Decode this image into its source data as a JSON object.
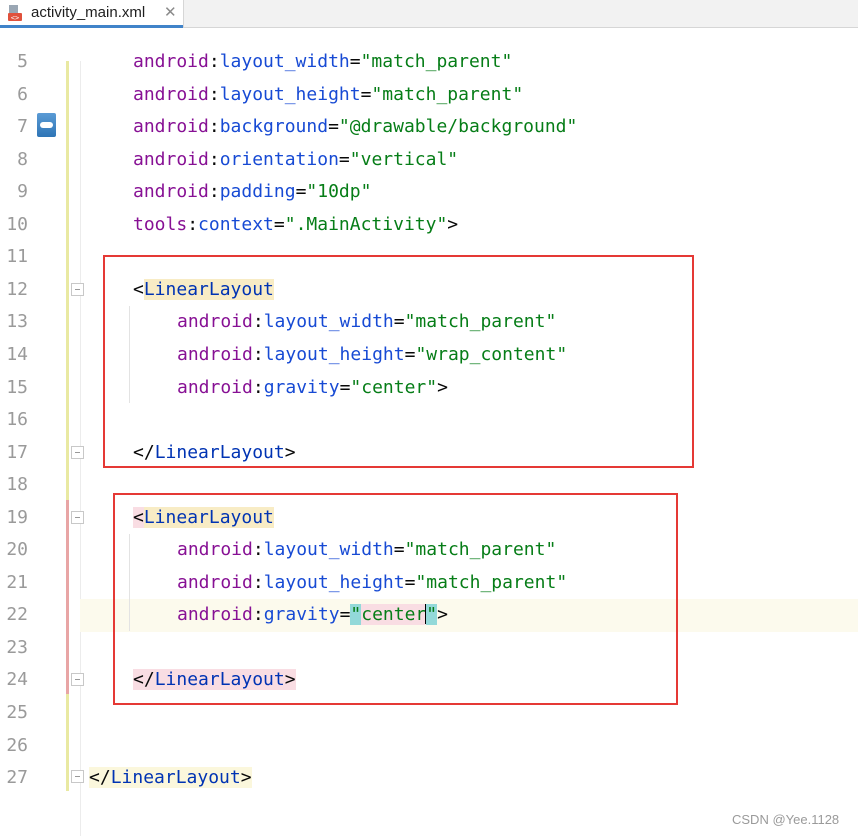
{
  "tab": {
    "title": "activity_main.xml",
    "close_glyph": "✕",
    "icon": "xml-file-icon"
  },
  "lines": [
    {
      "n": "5",
      "segments": [
        [
          "ns",
          "android"
        ],
        [
          "punc",
          ":"
        ],
        [
          "attr",
          "layout_width"
        ],
        [
          "punc",
          "="
        ],
        [
          "val",
          "\"match_parent\""
        ]
      ],
      "indent": 1
    },
    {
      "n": "6",
      "segments": [
        [
          "ns",
          "android"
        ],
        [
          "punc",
          ":"
        ],
        [
          "attr",
          "layout_height"
        ],
        [
          "punc",
          "="
        ],
        [
          "val",
          "\"match_parent\""
        ]
      ],
      "indent": 1
    },
    {
      "n": "7",
      "segments": [
        [
          "ns",
          "android"
        ],
        [
          "punc",
          ":"
        ],
        [
          "attr",
          "background"
        ],
        [
          "punc",
          "="
        ],
        [
          "val",
          "\"@drawable/background\""
        ]
      ],
      "indent": 1
    },
    {
      "n": "8",
      "segments": [
        [
          "ns",
          "android"
        ],
        [
          "punc",
          ":"
        ],
        [
          "attr",
          "orientation"
        ],
        [
          "punc",
          "="
        ],
        [
          "val",
          "\"vertical\""
        ]
      ],
      "indent": 1
    },
    {
      "n": "9",
      "segments": [
        [
          "ns",
          "android"
        ],
        [
          "punc",
          ":"
        ],
        [
          "attr",
          "padding"
        ],
        [
          "punc",
          "="
        ],
        [
          "val",
          "\"10dp\""
        ]
      ],
      "indent": 1
    },
    {
      "n": "10",
      "segments": [
        [
          "ns",
          "tools"
        ],
        [
          "punc",
          ":"
        ],
        [
          "attr",
          "context"
        ],
        [
          "punc",
          "="
        ],
        [
          "val",
          "\".MainActivity\""
        ],
        [
          "punc",
          ">"
        ]
      ],
      "indent": 1
    },
    {
      "n": "11",
      "segments": [],
      "indent": 0
    },
    {
      "n": "12",
      "segments": [
        [
          "punc",
          "<"
        ],
        [
          "tag tag-bg",
          "LinearLayout"
        ]
      ],
      "indent": 1
    },
    {
      "n": "13",
      "segments": [
        [
          "ns",
          "android"
        ],
        [
          "punc",
          ":"
        ],
        [
          "attr",
          "layout_width"
        ],
        [
          "punc",
          "="
        ],
        [
          "val",
          "\"match_parent\""
        ]
      ],
      "indent": 2
    },
    {
      "n": "14",
      "segments": [
        [
          "ns",
          "android"
        ],
        [
          "punc",
          ":"
        ],
        [
          "attr",
          "layout_height"
        ],
        [
          "punc",
          "="
        ],
        [
          "val",
          "\"wrap_content\""
        ]
      ],
      "indent": 2
    },
    {
      "n": "15",
      "segments": [
        [
          "ns",
          "android"
        ],
        [
          "punc",
          ":"
        ],
        [
          "attr",
          "gravity"
        ],
        [
          "punc",
          "="
        ],
        [
          "val",
          "\"center\""
        ],
        [
          "punc",
          ">"
        ]
      ],
      "indent": 2
    },
    {
      "n": "16",
      "segments": [],
      "indent": 0
    },
    {
      "n": "17",
      "segments": [
        [
          "punc",
          "</"
        ],
        [
          "tag",
          "LinearLayout"
        ],
        [
          "punc",
          ">"
        ]
      ],
      "indent": 1
    },
    {
      "n": "18",
      "segments": [],
      "indent": 0
    },
    {
      "n": "19",
      "segments": [
        [
          "punc tag-bg-pink",
          "<"
        ],
        [
          "tag tag-bg",
          "LinearLayout"
        ]
      ],
      "indent": 1
    },
    {
      "n": "20",
      "segments": [
        [
          "ns",
          "android"
        ],
        [
          "punc",
          ":"
        ],
        [
          "attr",
          "layout_width"
        ],
        [
          "punc",
          "="
        ],
        [
          "val",
          "\"match_parent\""
        ]
      ],
      "indent": 2
    },
    {
      "n": "21",
      "segments": [
        [
          "ns",
          "android"
        ],
        [
          "punc",
          ":"
        ],
        [
          "attr",
          "layout_height"
        ],
        [
          "punc",
          "="
        ],
        [
          "val",
          "\"match_parent\""
        ]
      ],
      "indent": 2
    },
    {
      "n": "22",
      "segments": [
        [
          "ns",
          "android"
        ],
        [
          "punc",
          ":"
        ],
        [
          "attr",
          "gravity"
        ],
        [
          "punc",
          "="
        ],
        [
          "val caret-hl",
          "\""
        ],
        [
          "val tag-bg-pink",
          "center"
        ],
        [
          "caret",
          ""
        ],
        [
          "val caret-hl",
          "\""
        ],
        [
          "punc",
          ">"
        ]
      ],
      "indent": 2,
      "current": true
    },
    {
      "n": "23",
      "segments": [],
      "indent": 0
    },
    {
      "n": "24",
      "segments": [
        [
          "punc tag-bg-pink",
          "</"
        ],
        [
          "tag tag-bg-pink",
          "LinearLayout"
        ],
        [
          "punc tag-bg-pink",
          ">"
        ]
      ],
      "indent": 1
    },
    {
      "n": "25",
      "segments": [],
      "indent": 0
    },
    {
      "n": "26",
      "segments": [],
      "indent": 0
    },
    {
      "n": "27",
      "segments": [
        [
          "punc tag-bg-yellow",
          "</"
        ],
        [
          "tag tag-bg-yellow",
          "LinearLayout"
        ],
        [
          "punc tag-bg-yellow",
          ">"
        ]
      ],
      "indent": 0
    }
  ],
  "watermark": "CSDN @Yee.1128",
  "colors": {
    "tag": "#0033b3",
    "namespace": "#871094",
    "attribute": "#174ad4",
    "value": "#067d17",
    "highlight_box": "#e53935"
  }
}
